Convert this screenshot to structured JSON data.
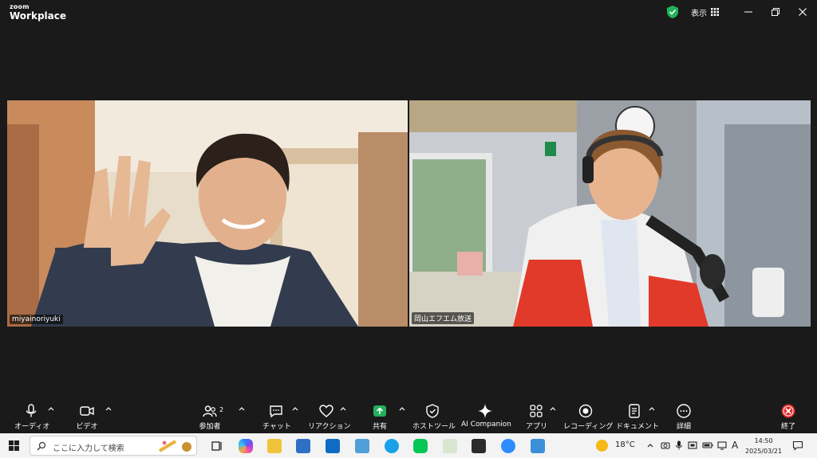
{
  "app": {
    "logo_line1": "zoom",
    "logo_line2": "Workplace",
    "view_label": "表示"
  },
  "participants": [
    {
      "name": "miyainoriyuki"
    },
    {
      "name": "岡山エフエム放送"
    }
  ],
  "toolbar": {
    "audio": "オーディオ",
    "video": "ビデオ",
    "participants": "参加者",
    "participants_count": "2",
    "chat": "チャット",
    "reactions": "リアクション",
    "share": "共有",
    "host_tools": "ホストツール",
    "ai_companion": "AI Companion",
    "apps": "アプリ",
    "recording": "レコーディング",
    "documents": "ドキュメント",
    "more": "詳細",
    "end": "終了"
  },
  "taskbar": {
    "search_placeholder": "ここに入力して検索",
    "temperature": "18°C",
    "time": "14:50",
    "date": "2025/03/21",
    "ime": "A"
  },
  "colors": {
    "share_green": "#22b05a",
    "end_red": "#e02828",
    "shield_green": "#20b45a",
    "background": "#1a1a1a"
  }
}
